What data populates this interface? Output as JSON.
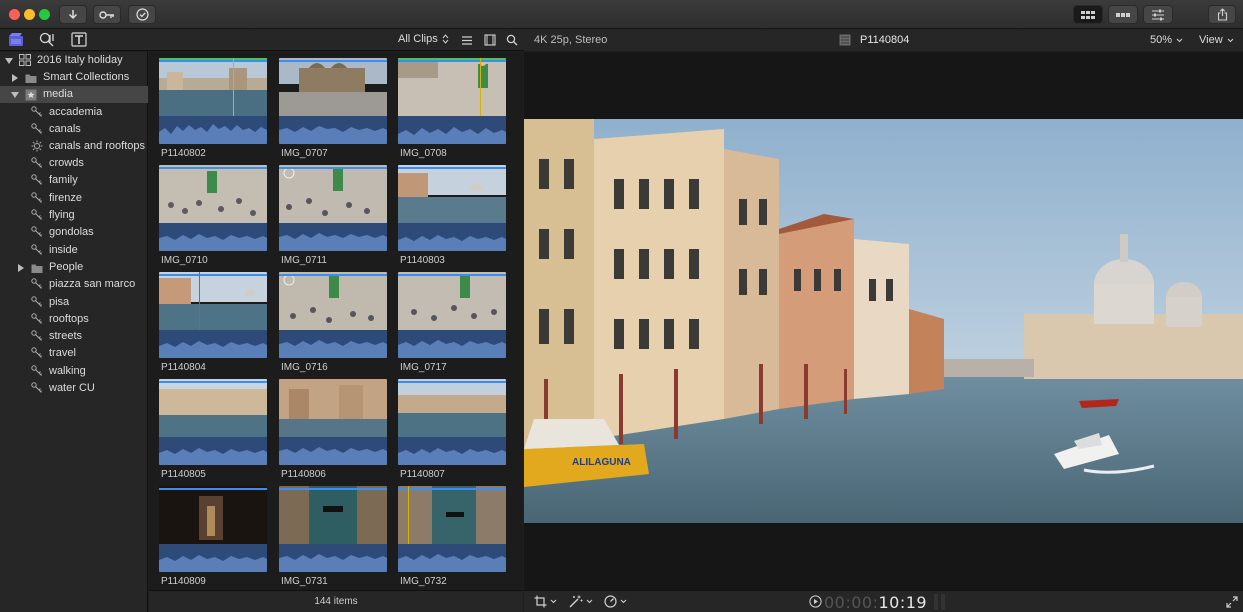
{
  "browser_toolbar": {
    "filter_label": "All Clips"
  },
  "sidebar": {
    "library": "2016 Italy holiday",
    "smart_collections": "Smart Collections",
    "event": "media",
    "keywords": [
      "accademia",
      "canals",
      "canals and rooftops",
      "crowds",
      "family",
      "firenze",
      "flying",
      "gondolas",
      "inside",
      "People",
      "piazza san marco",
      "pisa",
      "rooftops",
      "streets",
      "travel",
      "walking",
      "water CU"
    ]
  },
  "clips": [
    {
      "name": "P1140802"
    },
    {
      "name": "IMG_0707"
    },
    {
      "name": "IMG_0708"
    },
    {
      "name": "IMG_0710"
    },
    {
      "name": "IMG_0711"
    },
    {
      "name": "P1140803"
    },
    {
      "name": "P1140804"
    },
    {
      "name": "IMG_0716"
    },
    {
      "name": "IMG_0717"
    },
    {
      "name": "P1140805"
    },
    {
      "name": "P1140806"
    },
    {
      "name": "P1140807"
    },
    {
      "name": "P1140809"
    },
    {
      "name": "IMG_0731"
    },
    {
      "name": "IMG_0732"
    }
  ],
  "browser_status": "144 items",
  "viewer": {
    "format": "4K 25p, Stereo",
    "clip_name": "P1140804",
    "zoom": "50%",
    "view_menu": "View",
    "timecode_dim": "00:00:",
    "timecode": "10:19",
    "image_boat_sign": "ALILAGUNA"
  },
  "colors": {
    "accent_blue": "#3a8ef0",
    "waveform": "#2d4a78",
    "selection": "#464646"
  }
}
